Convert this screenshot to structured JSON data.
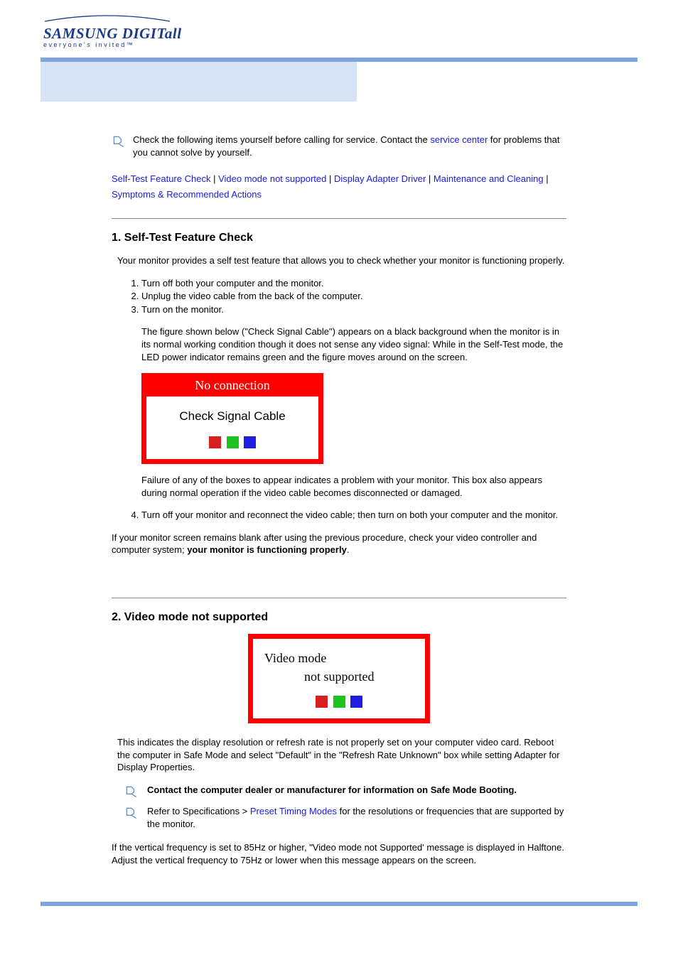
{
  "logo": {
    "line1": "SAMSUNG DIGITall",
    "line2": "everyone's invited™"
  },
  "intro": {
    "pre": "Check the following items yourself before calling for service. Contact the ",
    "service_center": "service center",
    "post": " for problems that you cannot solve by yourself."
  },
  "nav": {
    "l1": "Self-Test Feature Check",
    "l2": "Video mode not supported",
    "l3": "Display Adapter Driver",
    "l4": "Maintenance and Cleaning",
    "l5": "Symptoms & Recommended Actions"
  },
  "s1": {
    "title": "1. Self-Test Feature Check",
    "intro": "Your monitor provides a self test feature that allows you to check whether your monitor is functioning properly.",
    "step1": "Turn off both your computer and the monitor.",
    "step2": "Unplug the video cable from the back of the computer.",
    "step3": "Turn on the monitor.",
    "step3note": "The figure shown below (\"Check Signal Cable\") appears on a black background when the monitor is in its normal working condition though it does not sense any video signal: While in the Self-Test mode, the LED power indicator remains green and the figure moves around on the screen.",
    "fig_header": "No connection",
    "fig_body": "Check Signal Cable",
    "fail_note": "Failure of any of the boxes to appear indicates a problem with your monitor. This box also appears during normal operation if the video cable becomes disconnected or damaged.",
    "step4": "Turn off your monitor and reconnect the video cable; then turn on both your computer and the monitor.",
    "concl_pre": "If your monitor screen remains blank after using the previous procedure, check your video controller and computer system; ",
    "concl_bold": "your monitor is functioning properly",
    "concl_post": "."
  },
  "s2": {
    "title": "2. Video mode not supported",
    "fig_l1": "Video mode",
    "fig_l2": "not supported",
    "desc": "This indicates the display resolution or refresh rate is not properly set on your computer video card. Reboot the computer in Safe Mode and select \"Default\" in the \"Refresh Rate Unknown\" box while setting Adapter for Display Properties.",
    "contact": "Contact the computer dealer or manufacturer for information on Safe Mode Booting.",
    "refer_pre": "Refer to Specifications > ",
    "refer_link": "Preset Timing Modes",
    "refer_post": " for the resolutions or frequencies that are supported by the monitor.",
    "halftone": "If the vertical frequency is set to 85Hz or higher, \"Video mode not Supported' message is displayed in Halftone. Adjust the vertical frequency to 75Hz or lower when this message appears on the screen."
  }
}
